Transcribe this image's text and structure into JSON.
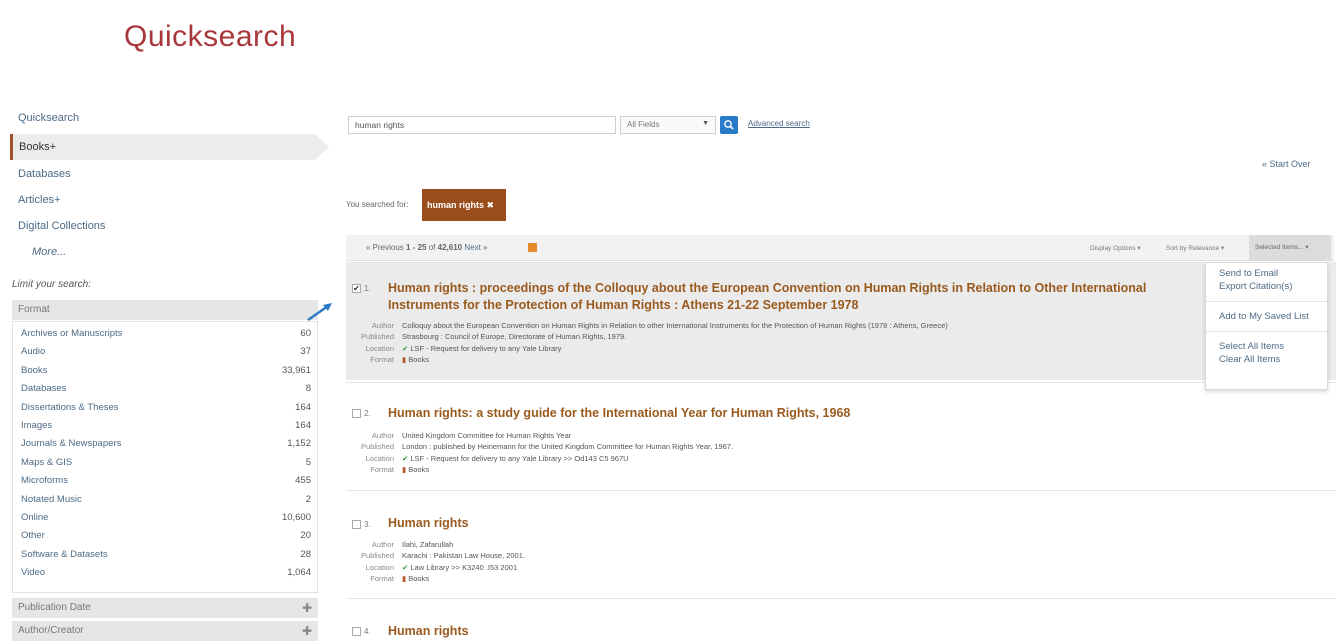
{
  "app_title": "Quicksearch",
  "nav": {
    "items": [
      "Quicksearch",
      "Books+",
      "Databases",
      "Articles+",
      "Digital Collections"
    ],
    "more": "More..."
  },
  "limit_title": "Limit your search:",
  "facets": {
    "format_head": "Format",
    "format_items": [
      {
        "label": "Archives or Manuscripts",
        "count": "60"
      },
      {
        "label": "Audio",
        "count": "37"
      },
      {
        "label": "Books",
        "count": "33,961"
      },
      {
        "label": "Databases",
        "count": "8"
      },
      {
        "label": "Dissertations & Theses",
        "count": "164"
      },
      {
        "label": "Images",
        "count": "164"
      },
      {
        "label": "Journals & Newspapers",
        "count": "1,152"
      },
      {
        "label": "Maps & GIS",
        "count": "5"
      },
      {
        "label": "Microforms",
        "count": "455"
      },
      {
        "label": "Notated Music",
        "count": "2"
      },
      {
        "label": "Online",
        "count": "10,600"
      },
      {
        "label": "Other",
        "count": "20"
      },
      {
        "label": "Software & Datasets",
        "count": "28"
      },
      {
        "label": "Video",
        "count": "1,064"
      }
    ],
    "pub_date": "Publication Date",
    "author": "Author/Creator"
  },
  "search": {
    "value": "human rights",
    "field": "All Fields",
    "advanced": "Advanced search"
  },
  "start_over": "« Start Over",
  "searched_for": "You searched for:",
  "query_tag": "human rights ✖",
  "toolbar": {
    "prev": "« Previous",
    "range": "1 - 25",
    "of": "of",
    "total": "42,610",
    "next": "Next »",
    "display": "Display Options ▾",
    "sort": "Sort by Relevance ▾",
    "selected": "Selected Items... ▾"
  },
  "dropdown": {
    "items": [
      "Send to Email",
      "Export Citation(s)",
      "Add to My Saved List",
      "Select All Items",
      "Clear All Items"
    ]
  },
  "labels": {
    "author": "Author",
    "published": "Published",
    "location": "Location",
    "format": "Format"
  },
  "results": [
    {
      "num": "1.",
      "title": "Human rights : proceedings of the Colloquy about the European Convention on Human Rights in Relation to Other International Instruments for the Protection of Human Rights : Athens 21-22 September 1978",
      "author": "Colloquy about the European Convention on Human Rights in Relation to other International Instruments for the Protection of Human Rights (1978 : Athens, Greece)",
      "published": "Strasbourg : Council of Europe, Directorate of Human Rights, 1979.",
      "location": "LSF - Request for delivery to any Yale Library",
      "format": "Books"
    },
    {
      "num": "2.",
      "title": "Human rights: a study guide for the International Year for Human Rights, 1968",
      "author": "United Kingdom Committee for Human Rights Year",
      "published": "London : published by Heinemann for the United Kingdom Committee for Human Rights Year, 1967.",
      "location": "LSF - Request for delivery to any Yale Library >> Od143 C5 967U",
      "format": "Books"
    },
    {
      "num": "3.",
      "title": "Human rights",
      "author": "Ilahi, Zafarullah",
      "published": "Karachi : Pakistan Law House, 2001.",
      "location": "Law Library >> K3240 .I53 2001",
      "format": "Books"
    },
    {
      "num": "4.",
      "title": "Human rights"
    }
  ]
}
